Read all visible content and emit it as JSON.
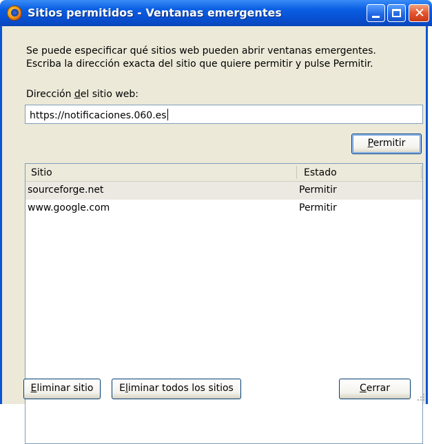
{
  "window": {
    "title": "Sitios permitidos - Ventanas emergentes",
    "title_icon": "firefox-icon"
  },
  "description": {
    "line1": "Se puede especificar qué sitios web pueden abrir ventanas emergentes.",
    "line2": "Escriba la dirección exacta del sitio que quiere permitir y pulse Permitir."
  },
  "address": {
    "label_pre": "Dirección ",
    "label_mnemonic": "d",
    "label_post": "el sitio web:",
    "value": "https://notificaciones.060.es"
  },
  "permit_button": {
    "mnemonic": "P",
    "rest": "ermitir"
  },
  "list": {
    "columns": [
      "Sitio",
      "Estado"
    ],
    "rows": [
      {
        "site": "sourceforge.net",
        "status": "Permitir",
        "selected": true
      },
      {
        "site": "www.google.com",
        "status": "Permitir",
        "selected": false
      }
    ]
  },
  "buttons": {
    "remove": {
      "mnemonic": "E",
      "rest": "liminar sitio"
    },
    "remove_all": {
      "pre": "E",
      "mnemonic": "l",
      "rest": "iminar todos los sitios"
    },
    "close": {
      "mnemonic": "C",
      "rest": "errar"
    }
  },
  "colors": {
    "titlebar": "#0a5fe3",
    "dialog_bg": "#ece9d8",
    "close_button": "#e5542e"
  }
}
